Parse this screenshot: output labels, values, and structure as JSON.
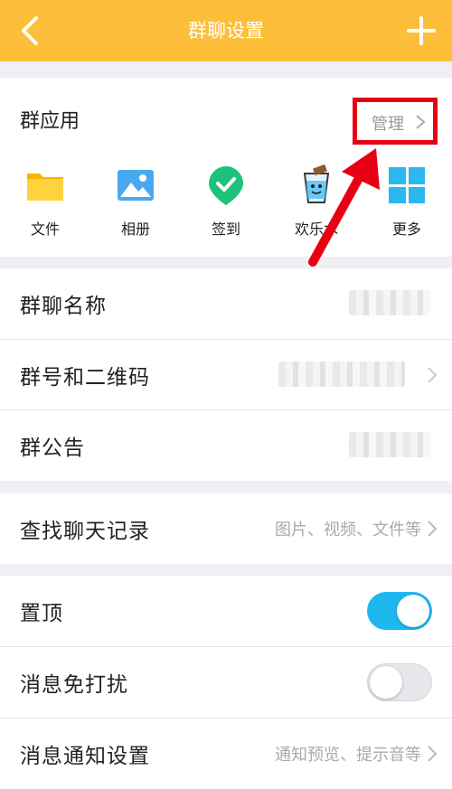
{
  "header": {
    "title": "群聊设置"
  },
  "apps": {
    "title": "群应用",
    "manage_label": "管理",
    "items": [
      {
        "label": "文件",
        "icon": "folder-icon"
      },
      {
        "label": "相册",
        "icon": "photo-album-icon"
      },
      {
        "label": "签到",
        "icon": "check-in-icon"
      },
      {
        "label": "欢乐水",
        "icon": "happy-water-cup-icon"
      },
      {
        "label": "更多",
        "icon": "grid-more-icon"
      }
    ]
  },
  "info_rows": [
    {
      "label": "群聊名称"
    },
    {
      "label": "群号和二维码"
    },
    {
      "label": "群公告"
    }
  ],
  "history": {
    "label": "查找聊天记录",
    "value": "图片、视频、文件等"
  },
  "settings": [
    {
      "label": "置顶",
      "toggle": true
    },
    {
      "label": "消息免打扰",
      "toggle": false
    },
    {
      "label": "消息通知设置",
      "value": "通知预览、提示音等"
    }
  ],
  "colors": {
    "header": "#fdbe3a",
    "toggle_on": "#1eb8ef",
    "highlight": "#e60012"
  }
}
